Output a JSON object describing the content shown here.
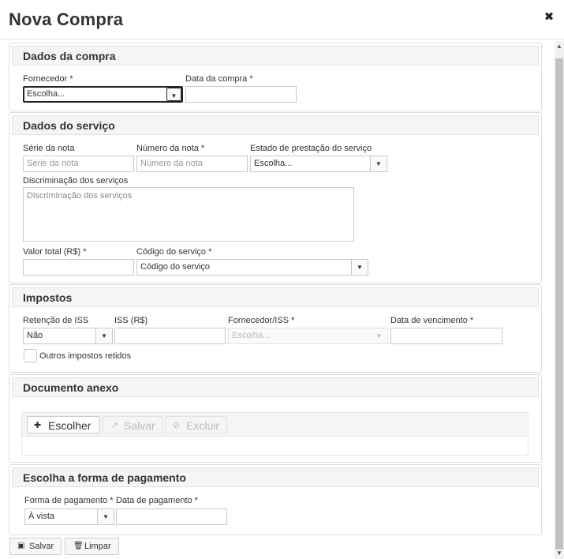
{
  "dialog": {
    "title": "Nova Compra",
    "close_glyph": "✖"
  },
  "dados_compra": {
    "heading": "Dados da compra",
    "fornecedor_label": "Fornecedor *",
    "fornecedor_value": "Escolha...",
    "data_compra_label": "Data da compra *",
    "data_compra_value": ""
  },
  "dados_servico": {
    "heading": "Dados do serviço",
    "serie_label": "Série da nota",
    "serie_placeholder": "Série da nota",
    "numero_label": "Número da nota *",
    "numero_placeholder": "Número da nota",
    "estado_label": "Estado de prestação do serviço",
    "estado_value": "Escolha...",
    "discriminacao_label": "Discriminação dos serviços",
    "discriminacao_placeholder": "Discriminação dos serviços",
    "valor_label": "Valor total (R$) *",
    "valor_value": "",
    "codigo_label": "Código do serviço *",
    "codigo_value": "Código do serviço"
  },
  "impostos": {
    "heading": "Impostos",
    "retencao_label": "Retenção de ISS",
    "retencao_value": "Não",
    "iss_label": "ISS (R$)",
    "iss_value": "",
    "fornecedor_iss_label": "Fornecedor/ISS *",
    "fornecedor_iss_value": "Escolha...",
    "vencimento_label": "Data de vencimento *",
    "vencimento_value": "",
    "outros_label": "Outros impostos retidos"
  },
  "documento": {
    "heading": "Documento anexo",
    "escolher_label": "Escolher",
    "salvar_label": "Salvar",
    "excluir_label": "Excluir"
  },
  "pagamento": {
    "heading": "Escolha a forma de pagamento",
    "forma_label": "Forma de pagamento *",
    "forma_value": "À vista",
    "data_label": "Data de pagamento *",
    "data_value": ""
  },
  "footer": {
    "salvar_label": "Salvar",
    "limpar_label": "Limpar"
  },
  "icons": {
    "dropdown": "chevron-down-icon",
    "plus": "plus-icon",
    "upload": "upload-icon",
    "cancel": "cancel-icon",
    "save": "save-icon",
    "trash": "trash-icon"
  }
}
